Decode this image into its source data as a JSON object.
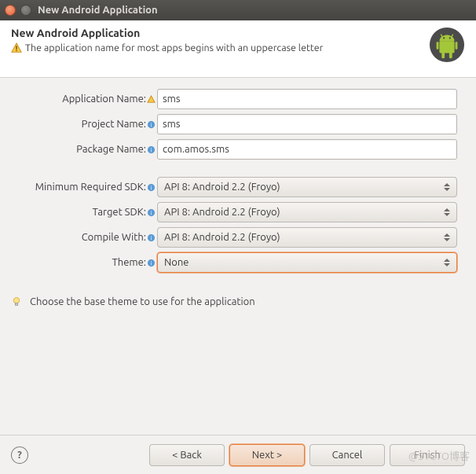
{
  "window": {
    "title": "New Android Application"
  },
  "header": {
    "title": "New Android Application",
    "message": "The application name for most apps begins with an uppercase letter"
  },
  "form": {
    "appName": {
      "label": "Application Name:",
      "value": "sms"
    },
    "projName": {
      "label": "Project Name:",
      "value": "sms"
    },
    "pkgName": {
      "label": "Package Name:",
      "value": "com.amos.sms"
    },
    "minSdk": {
      "label": "Minimum Required SDK:",
      "value": "API 8: Android 2.2 (Froyo)"
    },
    "targetSdk": {
      "label": "Target SDK:",
      "value": "API 8: Android 2.2 (Froyo)"
    },
    "compile": {
      "label": "Compile With:",
      "value": "API 8: Android 2.2 (Froyo)"
    },
    "theme": {
      "label": "Theme:",
      "value": "None"
    }
  },
  "hint": "Choose the base theme to use for the application",
  "footer": {
    "back": "< Back",
    "next": "Next >",
    "cancel": "Cancel",
    "finish": "Finish"
  },
  "watermark": "@51CTO博客"
}
